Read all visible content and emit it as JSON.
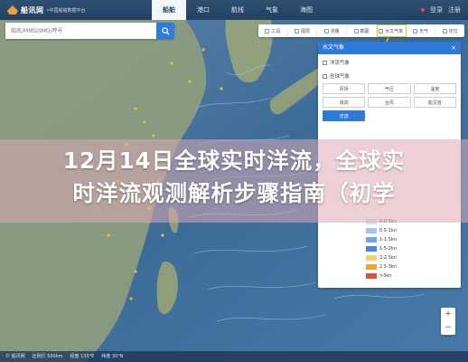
{
  "header": {
    "logo_name": "船讯网",
    "logo_tag": "•中国船舶数据平台",
    "nav": [
      "船舶",
      "港口",
      "航线",
      "气象",
      "海图"
    ],
    "active_nav": 0,
    "right_items": [
      "登录",
      "注册"
    ]
  },
  "search": {
    "placeholder": "船名/MMSI/IMO/呼号"
  },
  "toolbar": {
    "items": [
      "工具",
      "图层",
      "测量",
      "截图",
      "水文气象",
      "天气",
      "定位"
    ],
    "active_index": 4
  },
  "panel": {
    "title": "水文气象",
    "close": "×",
    "section1": "洋流气象",
    "section2": "全球气象",
    "row1": [
      "风场",
      "气压",
      "温度"
    ],
    "row2": [
      "浪高",
      "台风",
      "能见度"
    ],
    "row3": [
      "洋流"
    ],
    "active_tile": "洋流"
  },
  "legend": {
    "rows": [
      {
        "label": "0-0.5kn",
        "color": "#cfe3ff"
      },
      {
        "label": "0.5-1kn",
        "color": "#9fc7f5"
      },
      {
        "label": "1-1.5kn",
        "color": "#6fa6e8"
      },
      {
        "label": "1.5-2kn",
        "color": "#4a86d6"
      },
      {
        "label": "2-2.5kn",
        "color": "#f3d36b"
      },
      {
        "label": "2.5-3kn",
        "color": "#f0a23a"
      },
      {
        "label": ">3kn",
        "color": "#d9533b"
      }
    ]
  },
  "title": {
    "line1": "12月14日全球实时洋流，全球实",
    "line2": "时洋流观测解析步骤指南（初学"
  },
  "footer": {
    "text": [
      "© 船讯网",
      "比例尺 500km",
      "经度 135°E",
      "纬度 30°N"
    ]
  },
  "zoom": {
    "plus": "+",
    "minus": "−"
  }
}
